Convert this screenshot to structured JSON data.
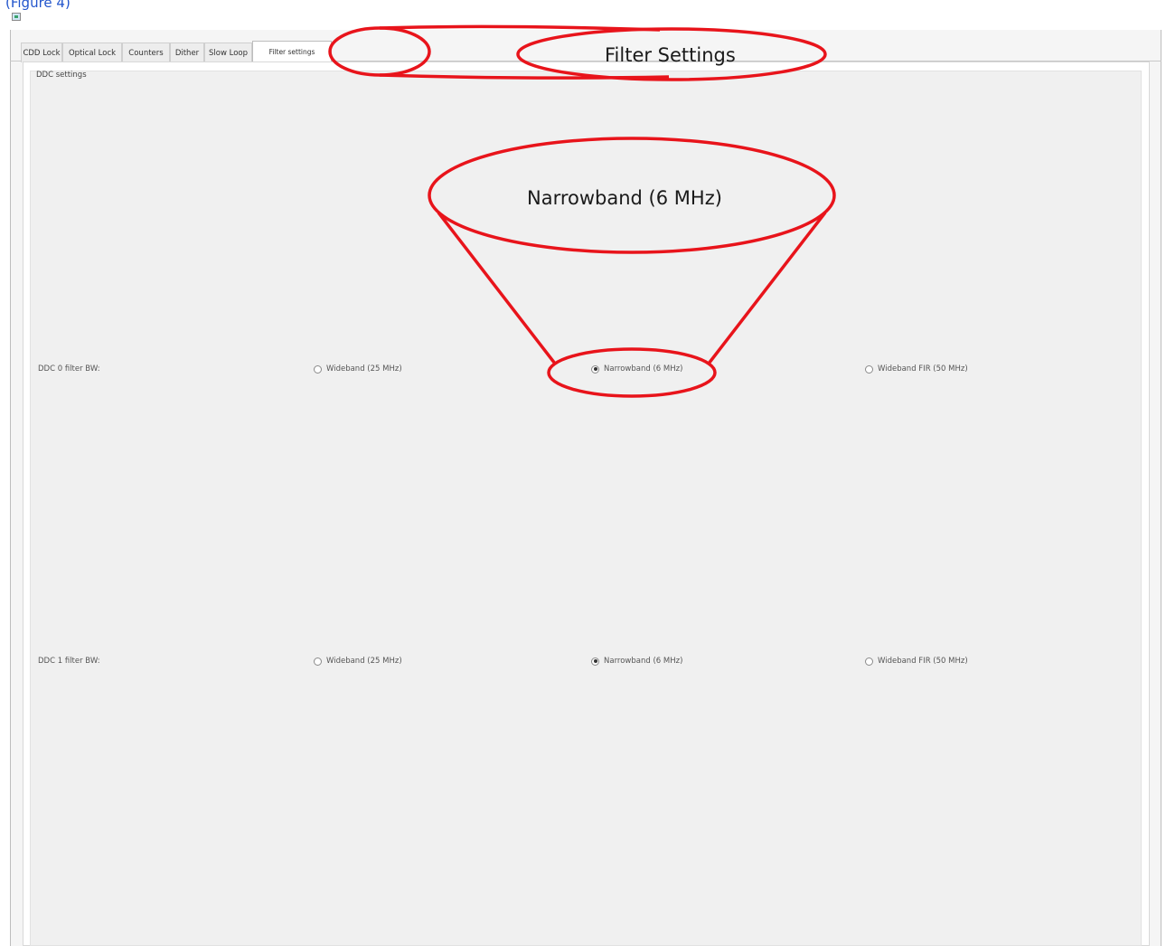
{
  "top_link": "(Figure 4)",
  "tabs": [
    {
      "label": "CDD Lock",
      "active": false
    },
    {
      "label": "Optical Lock",
      "active": false
    },
    {
      "label": "Counters",
      "active": false
    },
    {
      "label": "Dither",
      "active": false
    },
    {
      "label": "Slow Loop",
      "active": false
    },
    {
      "label": "Filter settings",
      "active": true
    }
  ],
  "group": {
    "title": "DDC settings",
    "rows": [
      {
        "label": "DDC 0 filter BW:",
        "options": [
          {
            "label": "Wideband (25 MHz)",
            "checked": false
          },
          {
            "label": "Narrowband (6 MHz)",
            "checked": true
          },
          {
            "label": "Wideband FIR (50 MHz)",
            "checked": false
          }
        ]
      },
      {
        "label": "DDC 1 filter BW:",
        "options": [
          {
            "label": "Wideband (25 MHz)",
            "checked": false
          },
          {
            "label": "Narrowband (6 MHz)",
            "checked": true
          },
          {
            "label": "Wideband FIR (50 MHz)",
            "checked": false
          }
        ]
      }
    ]
  },
  "annotations": {
    "filter_callout": "Filter Settings",
    "narrowband_callout": "Narrowband   (6 MHz)",
    "color": "#e8141b"
  }
}
